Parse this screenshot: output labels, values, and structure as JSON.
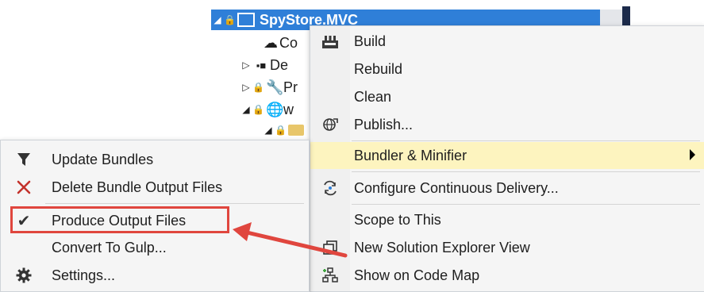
{
  "tree": {
    "root_label": "SpyStore.MVC",
    "row1_label": "Co",
    "row2_label": "De",
    "row3_label": "Pr",
    "row4_label": "w"
  },
  "context_menu": {
    "items": [
      {
        "label": "Build",
        "icon": "build-icon"
      },
      {
        "label": "Rebuild",
        "icon": ""
      },
      {
        "label": "Clean",
        "icon": ""
      },
      {
        "label": "Publish...",
        "icon": "globe-publish-icon"
      },
      {
        "label": "Bundler & Minifier",
        "icon": "",
        "highlighted": true
      },
      {
        "label": "Configure Continuous Delivery...",
        "icon": "continuous-delivery-icon"
      },
      {
        "label": "Scope to This",
        "icon": ""
      },
      {
        "label": "New Solution Explorer View",
        "icon": "new-view-icon"
      },
      {
        "label": "Show on Code Map",
        "icon": "code-map-icon"
      }
    ]
  },
  "submenu": {
    "items": [
      {
        "label": "Update Bundles",
        "icon": "funnel-icon"
      },
      {
        "label": "Delete Bundle Output Files",
        "icon": "delete-x-icon"
      },
      {
        "label": "Produce Output Files",
        "icon": "checkmark-icon",
        "checked": true
      },
      {
        "label": "Convert To Gulp...",
        "icon": ""
      },
      {
        "label": "Settings...",
        "icon": "gear-icon"
      }
    ]
  },
  "colors": {
    "selection": "#2f7fd8",
    "hover": "#fdf4bf",
    "callout": "#e0463e"
  }
}
